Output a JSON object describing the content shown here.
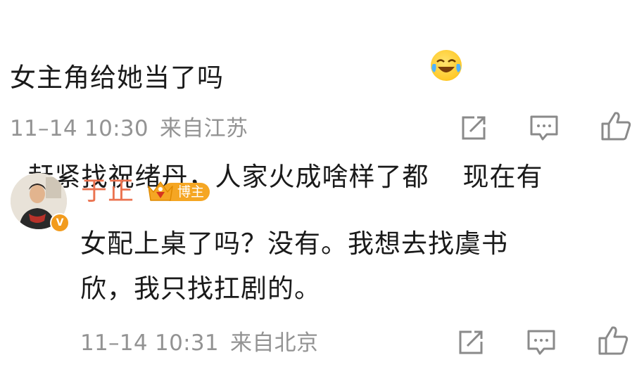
{
  "comment1": {
    "text_before_emoji": "赶紧找祝绪丹，人家火成啥样了都",
    "emoji": "laughing-crying-emoji",
    "text_after_emoji": "现在有",
    "line2": "女主角给她当了吗",
    "time": "11–14 10:30",
    "location": "来自江苏"
  },
  "reply": {
    "username": "于正",
    "badge_label": "博主",
    "line1": "女配上桌了吗？没有。我想去找虞书",
    "line2": "欣，我只找扛剧的。",
    "time": "11–14 10:31",
    "location": "来自北京"
  },
  "colors": {
    "username": "#eb7350",
    "meta_gray": "#939393",
    "badge_orange": "#f5a623",
    "verified_orange": "#f29b1d"
  },
  "icons": [
    "repost-icon",
    "comment-icon",
    "like-icon",
    "verified-badge-icon",
    "crown-icon"
  ]
}
